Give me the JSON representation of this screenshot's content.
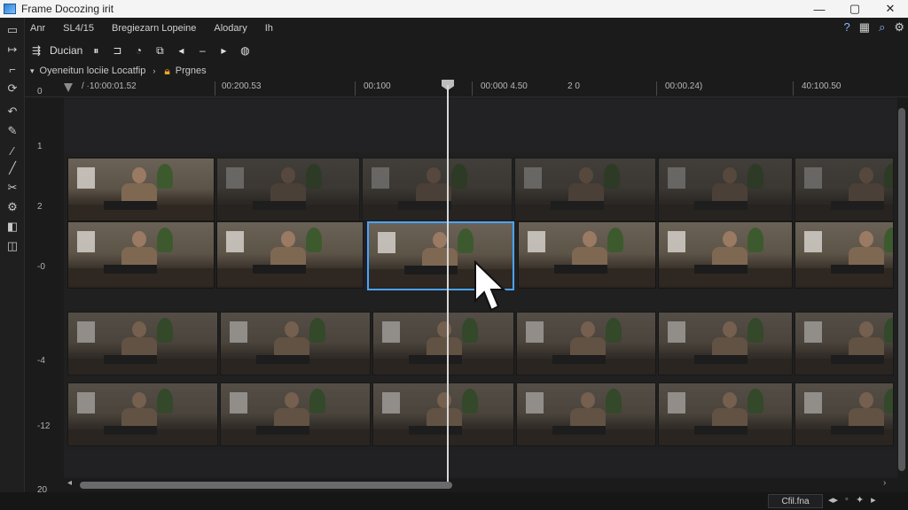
{
  "window": {
    "title": "Frame Docozing irit"
  },
  "menu": {
    "items": [
      "Anr",
      "SL4/15",
      "Bregiezarn Lopeine",
      "Alodary",
      "Ih"
    ]
  },
  "toolbar": {
    "label": "Ducian"
  },
  "track": {
    "name": "Oyeneitun lociie Locatfip",
    "tag": "Prgnes"
  },
  "ruler": {
    "ticks": [
      "/ ·10:00:01.52",
      "00:200.53",
      "00:100",
      "00:000 4.50",
      "2 0",
      "00:00.24)",
      "40:100.50"
    ]
  },
  "yaxis": {
    "labels": [
      "0",
      "1",
      "2",
      "-0",
      "-4",
      "-12",
      "20"
    ]
  },
  "status": {
    "value": "Cfil.fna"
  },
  "colors": {
    "accent": "#4aa3ff",
    "lock": "#f3a520",
    "background": "#1b1b1c"
  }
}
